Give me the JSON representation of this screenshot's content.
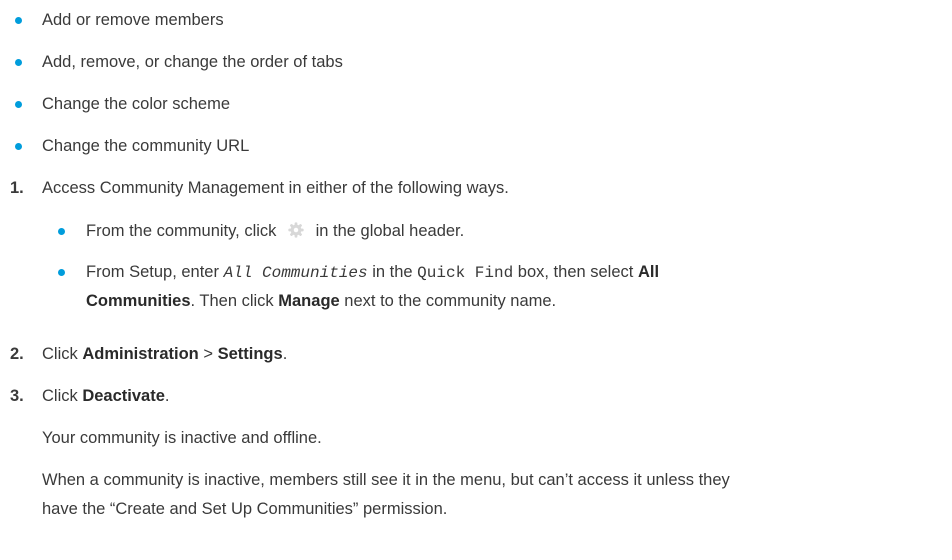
{
  "intro_bullets": [
    "Add or remove members",
    "Add, remove, or change the order of tabs",
    "Change the color scheme",
    "Change the community URL"
  ],
  "step1": {
    "num": "1.",
    "text": "Access Community Management in either of the following ways.",
    "sub1_before": "From the community, click",
    "sub1_after": "in the global header.",
    "sub2_a": "From Setup, enter",
    "sub2_code1": "All Communities",
    "sub2_b": "in the",
    "sub2_code2": "Quick Find",
    "sub2_c": "box, then select",
    "sub2_bold1": "All",
    "sub2_bold1_cont": "Communities",
    "sub2_d": ". Then click",
    "sub2_bold2": "Manage",
    "sub2_e": "next to the community name."
  },
  "step2": {
    "num": "2.",
    "a": "Click",
    "b1": "Administration",
    "sep": ">",
    "b2": "Settings",
    "end": "."
  },
  "step3": {
    "num": "3.",
    "a": "Click",
    "b1": "Deactivate",
    "end": ".",
    "line2": "Your community is inactive and offline.",
    "line3a": "When a community is inactive, members still see it in the menu, but can’t access it unless they",
    "line3b": "have the “Create and Set Up Communities” permission."
  }
}
